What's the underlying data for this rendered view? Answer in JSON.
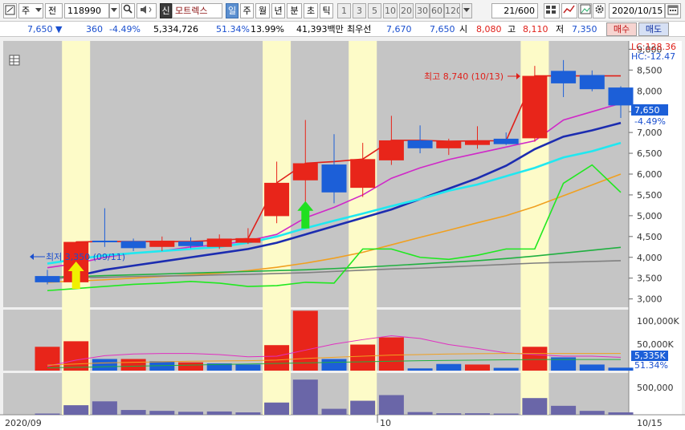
{
  "toolbar": {
    "market": "주",
    "period": "전",
    "code": "118990",
    "stock_name": "모트렉스",
    "name_badge": "신",
    "timeframes": [
      "일",
      "주",
      "월",
      "년",
      "분",
      "초",
      "틱"
    ],
    "selected_timeframe": "일",
    "intervals": [
      "1",
      "3",
      "5",
      "10",
      "20",
      "30",
      "60",
      "120"
    ],
    "count": "21",
    "count_total": "/600",
    "date": "2020/10/15"
  },
  "quote": {
    "price": "7,650",
    "change": "360",
    "change_pct": "-4.49%",
    "volume": "5,334,726",
    "volume_ratio": "51.34%",
    "turnover_rate": "13.99%",
    "amount": "41,393백만",
    "priority_label": "최우선",
    "ask": "7,670",
    "bid": "7,650",
    "open_label": "시",
    "open": "8,080",
    "high_label": "고",
    "high": "8,110",
    "low_label": "저",
    "low": "7,350",
    "buy_label": "매수",
    "sell_label": "매도"
  },
  "chart_data": {
    "type": "candlestick",
    "lc": "LC:128.36",
    "hc": "HC:-12.47",
    "price_axis": [
      "9,000",
      "8,500",
      "8,000",
      "7,500",
      "7,000",
      "6,500",
      "6,000",
      "5,500",
      "5,000",
      "4,500",
      "4,000",
      "3,500",
      "3,000"
    ],
    "ylim": [
      2800,
      9200
    ],
    "current_price_label": "7,650",
    "current_change_label": "-4.49%",
    "volume_axis": [
      "100,000K",
      "50,000K"
    ],
    "volume_current_label": "5,335K",
    "volume_pct_label": "51.34%",
    "volume_ylim": [
      0,
      110000
    ],
    "lower_axis": [
      "500,000"
    ],
    "lower_ylim": [
      0,
      700000
    ],
    "max_annotation": "최고 8,740 (10/13)",
    "min_annotation": "최저 3,350 (09/11)",
    "x_labels": [
      "2020/09",
      "10",
      "10/15"
    ],
    "candles": [
      {
        "o": 3550,
        "h": 3700,
        "l": 3350,
        "c": 3400
      },
      {
        "o": 3400,
        "h": 4380,
        "l": 3380,
        "c": 4370
      },
      {
        "o": 4400,
        "h": 5180,
        "l": 4250,
        "c": 4380
      },
      {
        "o": 4390,
        "h": 4450,
        "l": 4150,
        "c": 4220
      },
      {
        "o": 4250,
        "h": 4500,
        "l": 4150,
        "c": 4400
      },
      {
        "o": 4380,
        "h": 4480,
        "l": 4220,
        "c": 4270
      },
      {
        "o": 4250,
        "h": 4550,
        "l": 4200,
        "c": 4450
      },
      {
        "o": 4350,
        "h": 4700,
        "l": 4320,
        "c": 4460
      },
      {
        "o": 4990,
        "h": 6300,
        "l": 4820,
        "c": 5790
      },
      {
        "o": 5850,
        "h": 7300,
        "l": 5200,
        "c": 6260
      },
      {
        "o": 6230,
        "h": 6960,
        "l": 5300,
        "c": 5560
      },
      {
        "o": 5670,
        "h": 6750,
        "l": 5450,
        "c": 6360
      },
      {
        "o": 6330,
        "h": 7400,
        "l": 6220,
        "c": 6810
      },
      {
        "o": 6810,
        "h": 7170,
        "l": 6500,
        "c": 6620
      },
      {
        "o": 6620,
        "h": 6850,
        "l": 6460,
        "c": 6790
      },
      {
        "o": 6700,
        "h": 7150,
        "l": 6610,
        "c": 6800
      },
      {
        "o": 6850,
        "h": 7000,
        "l": 6700,
        "c": 6720
      },
      {
        "o": 6860,
        "h": 8600,
        "l": 6780,
        "c": 8360
      },
      {
        "o": 8480,
        "h": 8740,
        "l": 7850,
        "c": 8180
      },
      {
        "o": 8380,
        "h": 8490,
        "l": 7990,
        "c": 8040
      },
      {
        "o": 8080,
        "h": 8110,
        "l": 7350,
        "c": 7650
      }
    ],
    "highlighted_candles": [
      1,
      8,
      11,
      17
    ],
    "moving_averages": [
      {
        "color": "#e0201a",
        "values": [
          null,
          4370,
          4380,
          4380,
          4380,
          4380,
          4410,
          4450,
          5790,
          6260,
          6300,
          6360,
          6810,
          6810,
          6790,
          6800,
          6800,
          8360,
          8360,
          8360,
          8360
        ]
      },
      {
        "color": "#d028c8",
        "values": [
          3750,
          3850,
          4000,
          4100,
          4150,
          4250,
          4300,
          4400,
          4550,
          4950,
          5200,
          5500,
          5900,
          6150,
          6350,
          6500,
          6650,
          6800,
          7300,
          7500,
          7700
        ]
      },
      {
        "color": "#1c2cb0",
        "values": [
          3480,
          3550,
          3700,
          3800,
          3900,
          4000,
          4100,
          4200,
          4350,
          4550,
          4750,
          4950,
          5150,
          5400,
          5650,
          5900,
          6200,
          6600,
          6900,
          7050,
          7230
        ]
      },
      {
        "color": "#20e8f0",
        "values": [
          3850,
          3950,
          4050,
          4100,
          4150,
          4200,
          4250,
          4350,
          4500,
          4700,
          4880,
          5050,
          5230,
          5400,
          5600,
          5750,
          5950,
          6150,
          6400,
          6550,
          6750
        ]
      },
      {
        "color": "#f0a020",
        "values": [
          3400,
          3430,
          3460,
          3500,
          3540,
          3580,
          3620,
          3680,
          3760,
          3860,
          3980,
          4120,
          4300,
          4480,
          4650,
          4830,
          5000,
          5220,
          5480,
          5740,
          6000
        ]
      },
      {
        "color": "#20b040",
        "values": [
          3520,
          3540,
          3560,
          3580,
          3600,
          3620,
          3640,
          3660,
          3680,
          3700,
          3730,
          3760,
          3800,
          3840,
          3880,
          3920,
          3970,
          4030,
          4100,
          4170,
          4240
        ]
      },
      {
        "color": "#808080",
        "values": [
          3500,
          3510,
          3520,
          3540,
          3550,
          3560,
          3580,
          3590,
          3610,
          3630,
          3660,
          3690,
          3720,
          3740,
          3770,
          3800,
          3830,
          3860,
          3880,
          3900,
          3920
        ]
      },
      {
        "color": "#20e820",
        "values": [
          3200,
          3250,
          3300,
          3350,
          3380,
          3420,
          3380,
          3300,
          3320,
          3400,
          3380,
          4200,
          4200,
          4000,
          3950,
          4050,
          4200,
          4200,
          5780,
          6220,
          5560
        ]
      }
    ],
    "up_arrows": [
      {
        "index": 1,
        "color": "#f0f000",
        "price": 3900
      },
      {
        "index": 9,
        "color": "#20e020",
        "price": 5350
      }
    ],
    "volumes": [
      43000,
      53000,
      21000,
      21000,
      17000,
      15000,
      13000,
      11000,
      46000,
      108000,
      21000,
      47000,
      60000,
      4000,
      12000,
      11000,
      5000,
      43000,
      24000,
      11000,
      5335
    ],
    "volume_colors": [
      "r",
      "r",
      "b",
      "r",
      "b",
      "r",
      "b",
      "b",
      "r",
      "r",
      "b",
      "r",
      "r",
      "b",
      "b",
      "r",
      "b",
      "r",
      "b",
      "b",
      "b"
    ],
    "volume_ma1": [
      8000,
      19000,
      27000,
      30000,
      31000,
      31000,
      29000,
      25000,
      26000,
      37000,
      48000,
      56000,
      63000,
      58000,
      47000,
      40000,
      32000,
      29000,
      26000,
      26000,
      24000
    ],
    "volume_ma2": [
      10000,
      12000,
      14000,
      15000,
      16000,
      17000,
      17500,
      18000,
      19000,
      22000,
      24000,
      26000,
      28000,
      29000,
      30000,
      30500,
      31000,
      31000,
      31000,
      31000,
      31000
    ],
    "volume_ma3": [
      5000,
      6000,
      7000,
      8000,
      9000,
      10000,
      11000,
      12000,
      13000,
      14000,
      15000,
      16000,
      17000,
      18000,
      18500,
      19000,
      19500,
      20000,
      20000,
      20000,
      20000
    ],
    "lower_values": [
      20000,
      160000,
      225000,
      80000,
      65000,
      50000,
      55000,
      40000,
      205000,
      590000,
      100000,
      235000,
      330000,
      45000,
      25000,
      25000,
      20000,
      280000,
      150000,
      65000,
      40000
    ]
  }
}
